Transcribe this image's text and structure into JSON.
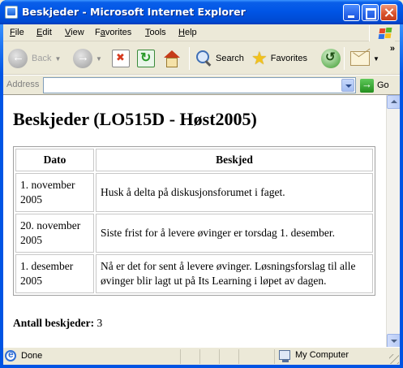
{
  "window": {
    "title": "Beskjeder - Microsoft Internet Explorer"
  },
  "menu": {
    "items": [
      {
        "key": "F",
        "rest": "ile"
      },
      {
        "key": "E",
        "rest": "dit"
      },
      {
        "key": "V",
        "rest": "iew"
      },
      {
        "pre": "F",
        "key": "a",
        "rest": "vorites"
      },
      {
        "key": "T",
        "rest": "ools"
      },
      {
        "key": "H",
        "rest": "elp"
      }
    ]
  },
  "toolbar": {
    "back_label": "Back",
    "search_label": "Search",
    "favorites_label": "Favorites",
    "overflow": "»"
  },
  "address": {
    "label": "Address",
    "value": "",
    "go_label": "Go"
  },
  "page": {
    "heading": "Beskjeder (LO515D - Høst2005)",
    "table": {
      "headers": {
        "date": "Dato",
        "message": "Beskjed"
      },
      "rows": [
        {
          "date": "1. november 2005",
          "message": "Husk å delta på diskusjonsforumet i faget."
        },
        {
          "date": "20. november 2005",
          "message": "Siste frist for å levere øvinger er torsdag 1. desember."
        },
        {
          "date": "1. desember 2005",
          "message": "Nå er det for sent å levere øvinger. Løsningsforslag til alle øvinger blir lagt ut på Its Learning i løpet av dagen."
        }
      ]
    },
    "summary_label": "Antall beskjeder:",
    "summary_count": "3"
  },
  "status": {
    "text": "Done",
    "zone": "My Computer"
  },
  "colors": {
    "titlebar": "#0054e3",
    "chrome": "#ece9d8",
    "close_button": "#d9542f"
  }
}
